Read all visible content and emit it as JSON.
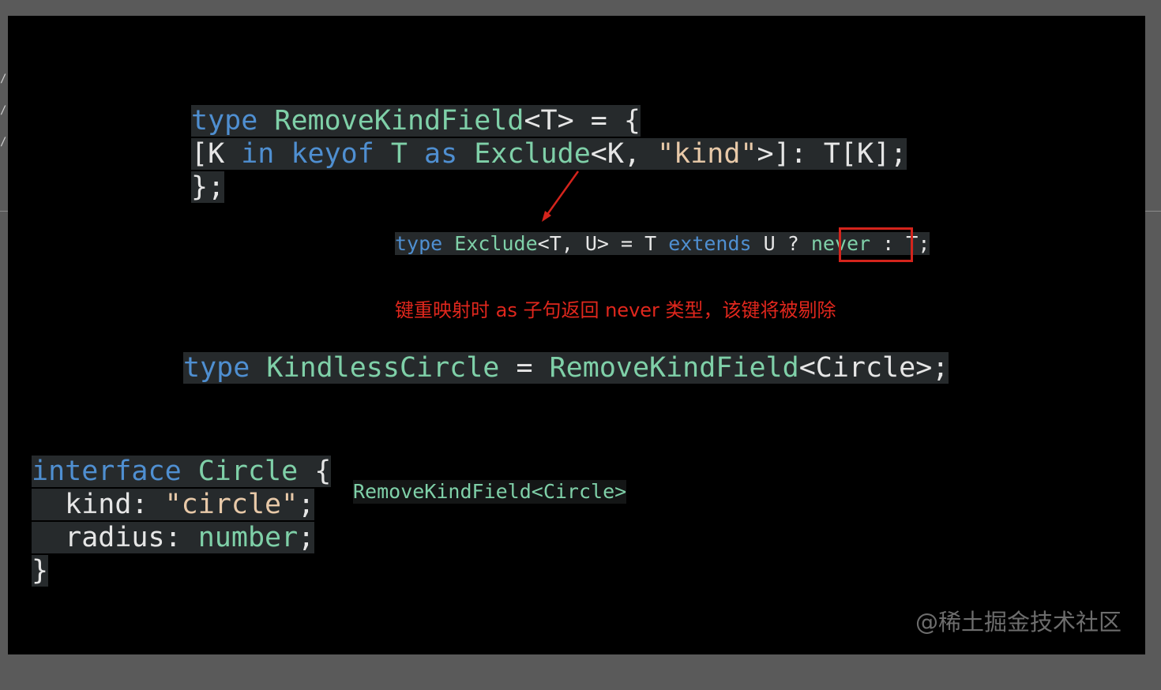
{
  "code_block_1": {
    "line1": {
      "kw": "type",
      "name": "RemoveKindField",
      "rest": "<T> = {"
    },
    "line2": {
      "open": "[K ",
      "in": "in",
      "keyof": "keyof",
      "t": " T ",
      "as": "as",
      "excl": "Exclude",
      "rest": "<K, ",
      "str": "\"kind\"",
      "end": ">]: T[K];"
    },
    "line3": "};"
  },
  "code_block_2": {
    "kw": "type",
    "name": "Exclude",
    "params": "<T, U> = T ",
    "extends": "extends",
    "mid": " U ? ",
    "never": "never",
    "end": " : T;"
  },
  "annotation": "键重映射时 as 子句返回 never 类型，该键将被剔除",
  "code_block_3": {
    "kw": "type",
    "name": "KindlessCircle",
    "eq": " = ",
    "fn": "RemoveKindField",
    "arg": "<Circle>;"
  },
  "code_block_4": {
    "line1": {
      "kw": "interface",
      "name": "Circle",
      "brace": " {"
    },
    "line2": {
      "prop": "  kind",
      "colon": ": ",
      "val": "\"circle\"",
      "semi": ";"
    },
    "line3": {
      "prop": "  radius",
      "colon": ": ",
      "val": "number",
      "semi": ";"
    },
    "line4": "}"
  },
  "label": "RemoveKindField<Circle>",
  "watermark": "@稀土掘金技术社区",
  "colors": {
    "keyword": "#4f8fd1",
    "type": "#7fd0a8",
    "string": "#e8c9a8",
    "annotation": "#e0271d",
    "highlight_box": "#d4241c"
  }
}
